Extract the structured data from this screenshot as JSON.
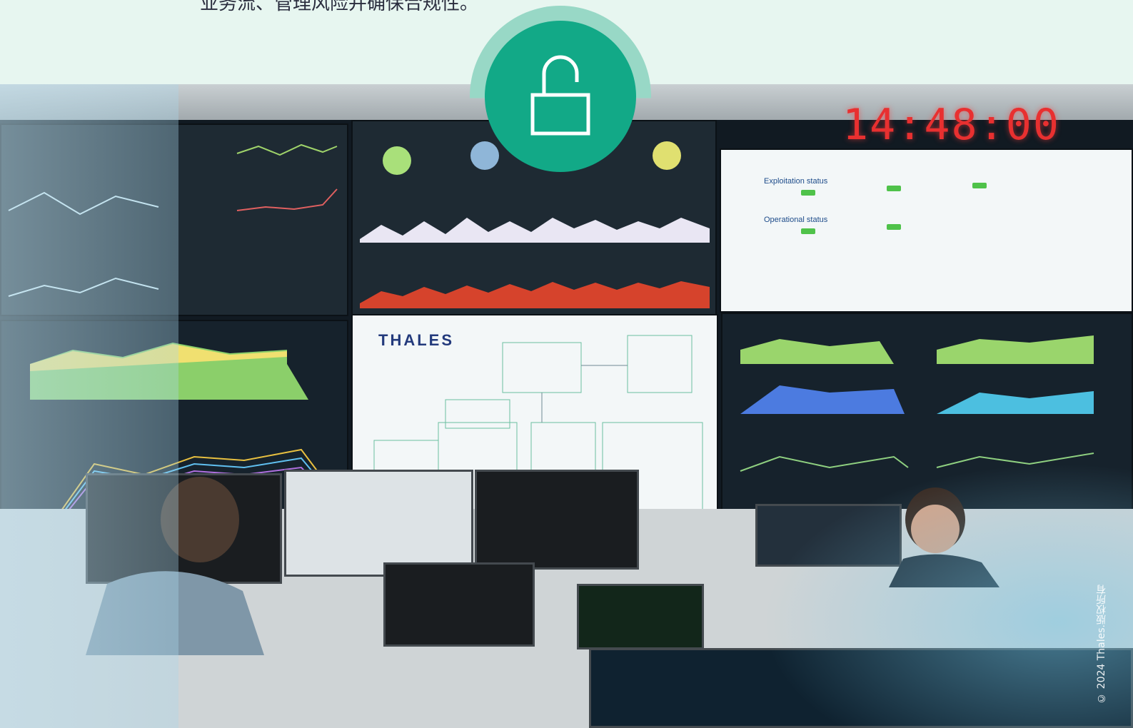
{
  "intro": {
    "text": "业务流、管理风险并确保合规性。"
  },
  "control_room": {
    "clock": "14:48:00",
    "logo": "THALES",
    "status_labels": [
      "Exploitation status",
      "Operational status"
    ]
  },
  "lock_badge": {
    "icon": "unlocked-padlock-icon",
    "color": "#12a987",
    "halo_color": "#98d8c6"
  },
  "copyright": "© 2024 Thales.版权所有"
}
